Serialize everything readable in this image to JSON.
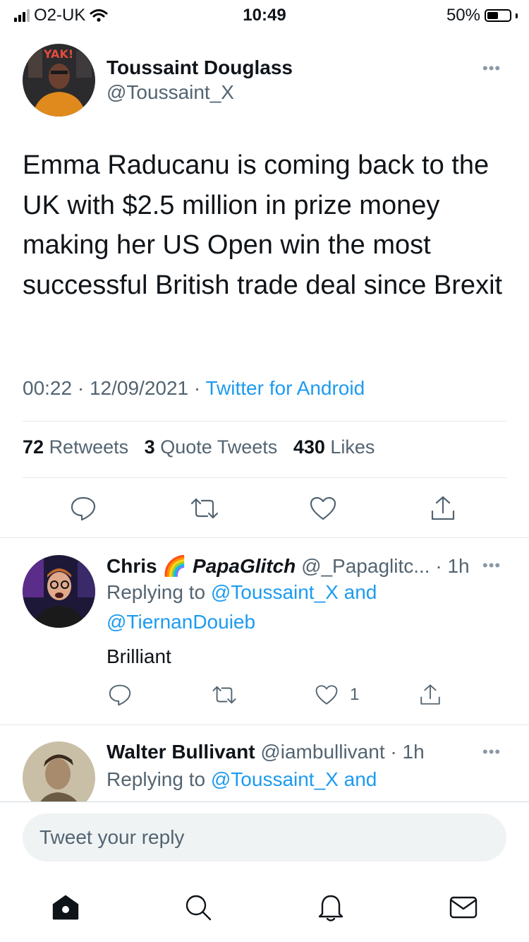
{
  "status_bar": {
    "carrier": "O2-UK",
    "time": "10:49",
    "battery": "50%",
    "battery_level": 0.5
  },
  "main_tweet": {
    "author_name": "Toussaint Douglass",
    "author_handle": "@Toussaint_X",
    "text": "Emma Raducanu is coming back to the UK with $2.5 million in prize money making her US Open win the most successful British trade deal since Brexit",
    "time": "00:22",
    "date": "12/09/2021",
    "source": "Twitter for Android",
    "separator": "·",
    "retweets_count": "72",
    "retweets_label": "Retweets",
    "quote_count": "3",
    "quote_label": "Quote Tweets",
    "likes_count": "430",
    "likes_label": "Likes"
  },
  "replies": [
    {
      "name": "Chris",
      "emoji": "🌈",
      "display_extra": "PapaGlitch",
      "handle": "@_Papaglitc...",
      "age": "· 1h",
      "replying_prefix": "Replying to",
      "replying_to_1": "@Toussaint_X",
      "and": "and",
      "replying_to_2": "@TiernanDouieb",
      "text": "Brilliant",
      "like_count": "1"
    },
    {
      "name": "Walter Bullivant",
      "handle": "@iambullivant",
      "age": "· 1h",
      "replying_prefix": "Replying to",
      "replying_to_1": "@Toussaint_X",
      "and": "and"
    }
  ],
  "compose": {
    "placeholder": "Tweet your reply"
  },
  "tab_bar": {
    "items": [
      "home-icon",
      "search-icon",
      "notifications-icon",
      "messages-icon"
    ]
  },
  "colors": {
    "accent": "#1d9bf0",
    "text": "#0f1419",
    "secondary": "#536471",
    "divider": "#e5e7eb",
    "compose_bg": "#eff3f4"
  }
}
